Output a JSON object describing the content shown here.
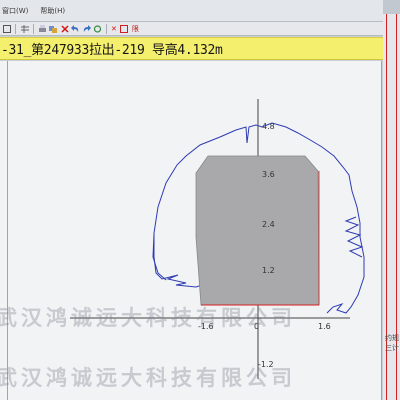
{
  "menu": {
    "items": [
      {
        "label": "窗口(W)"
      },
      {
        "label": "帮助(H)"
      }
    ]
  },
  "toolbar": {
    "icons": [
      "square-icon",
      "grid-icon",
      "print-icon",
      "layers-icon",
      "delete-icon",
      "undo-icon",
      "redo-icon",
      "refresh-icon",
      "close-icon"
    ],
    "close_glyph": "✕",
    "trailing_label": "限"
  },
  "section": {
    "title": "-31_第247933拉出-219 导高4.132m"
  },
  "plot": {
    "y_ticks": [
      "4.8",
      "3.6",
      "2.4",
      "1.2"
    ],
    "x_ticks": [
      "-1.6",
      "0",
      "1.6",
      "-1.2"
    ]
  },
  "right_panel": {
    "labels": [
      "约规",
      "三计"
    ]
  },
  "watermark": {
    "text": "武汉鸿诚远大科技有限公司"
  },
  "colors": {
    "title_background": "#f5ef6e",
    "profile_stroke": "#2f3bb3",
    "tunnel_fill": "#a9a9ab",
    "accent_red": "#d42020"
  }
}
